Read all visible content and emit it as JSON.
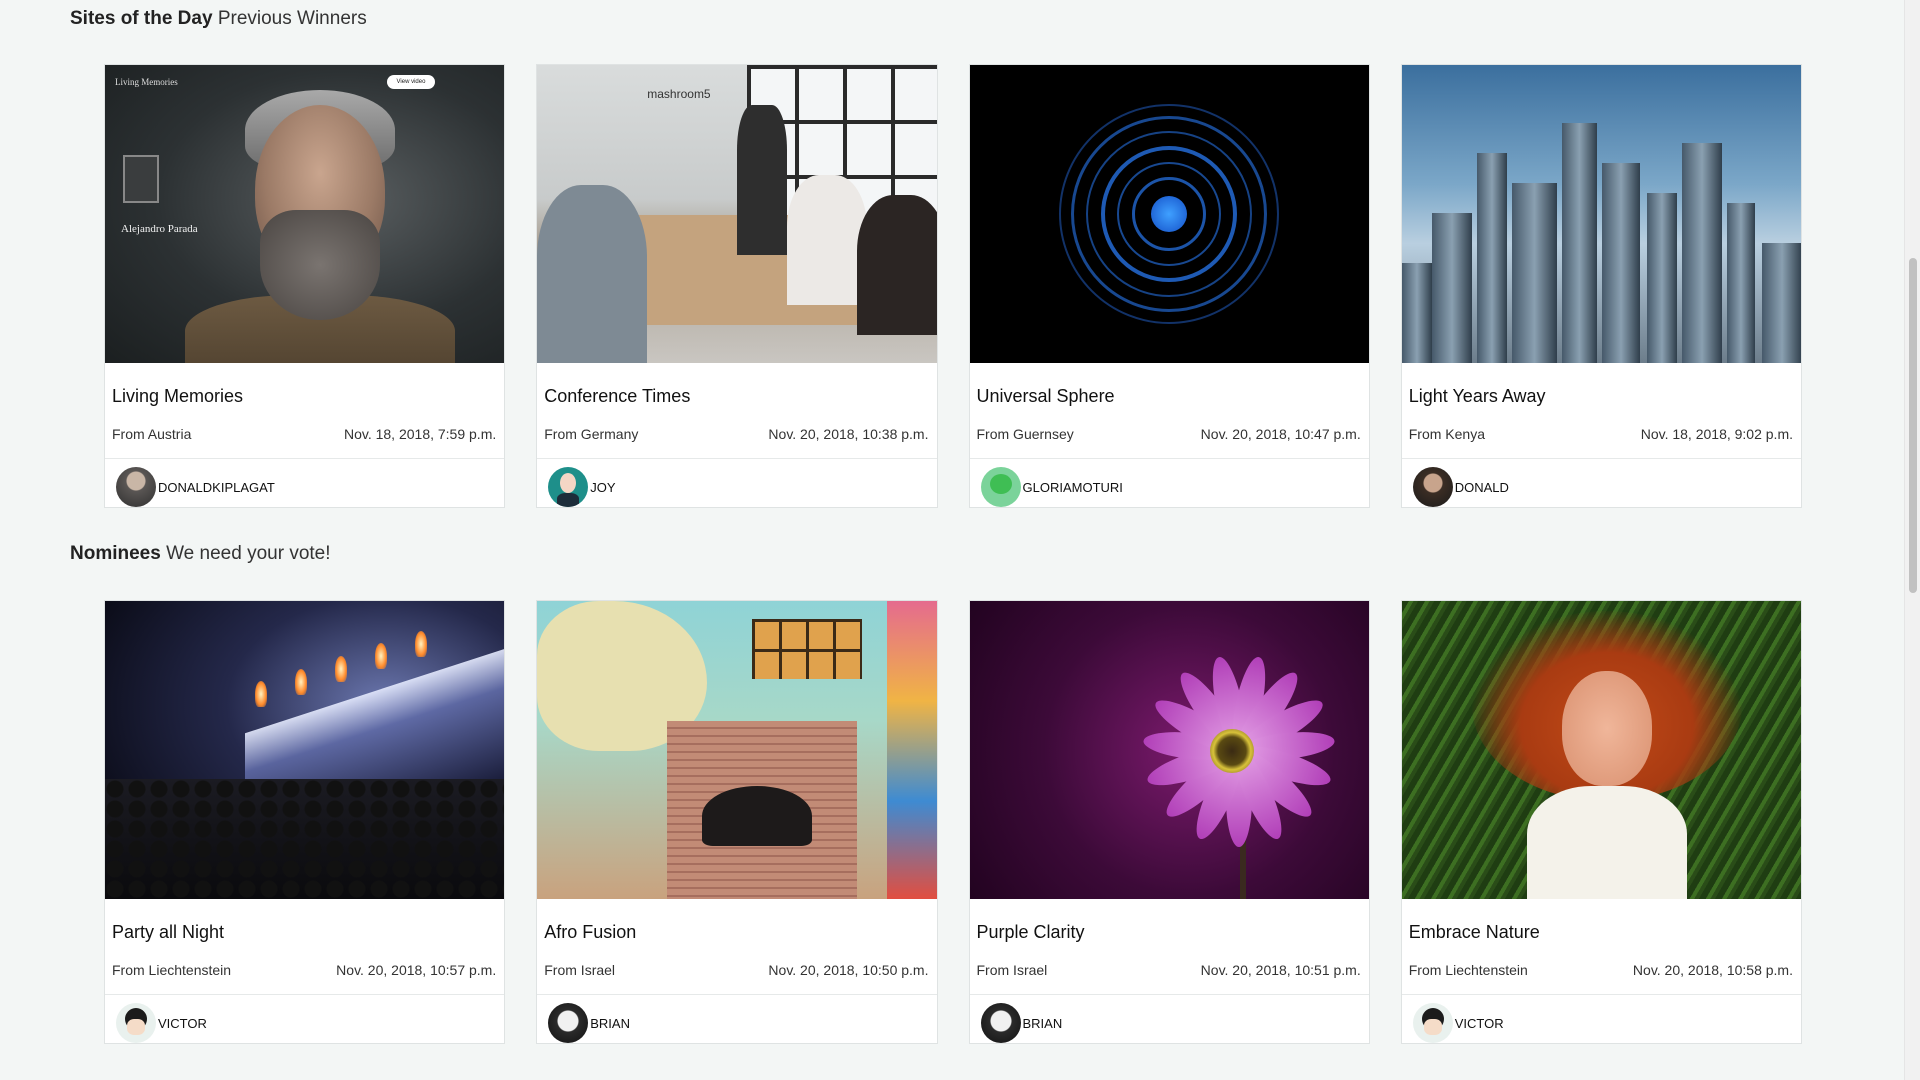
{
  "sections": {
    "winners": {
      "title": "Sites of the Day",
      "subtitle": "Previous Winners"
    },
    "nominees": {
      "title": "Nominees",
      "subtitle": "We need your vote!"
    }
  },
  "winners": [
    {
      "title": "Living Memories",
      "from": "From Austria",
      "date": "Nov. 18, 2018, 7:59 p.m.",
      "author": "DONALDKIPLAGAT",
      "thumb_text": {
        "logo": "Living Memories",
        "name": "Alejandro Parada",
        "button": "View video"
      }
    },
    {
      "title": "Conference Times",
      "from": "From Germany",
      "date": "Nov. 20, 2018, 10:38 p.m.",
      "author": "JOY",
      "thumb_text": {
        "label": "mashroom5"
      }
    },
    {
      "title": "Universal Sphere",
      "from": "From Guernsey",
      "date": "Nov. 20, 2018, 10:47 p.m.",
      "author": "GLORIAMOTURI"
    },
    {
      "title": "Light Years Away",
      "from": "From Kenya",
      "date": "Nov. 18, 2018, 9:02 p.m.",
      "author": "DONALD"
    }
  ],
  "nominees": [
    {
      "title": "Party all Night",
      "from": "From Liechtenstein",
      "date": "Nov. 20, 2018, 10:57 p.m.",
      "author": "VICTOR"
    },
    {
      "title": "Afro Fusion",
      "from": "From Israel",
      "date": "Nov. 20, 2018, 10:50 p.m.",
      "author": "BRIAN"
    },
    {
      "title": "Purple Clarity",
      "from": "From Israel",
      "date": "Nov. 20, 2018, 10:51 p.m.",
      "author": "BRIAN"
    },
    {
      "title": "Embrace Nature",
      "from": "From Liechtenstein",
      "date": "Nov. 20, 2018, 10:58 p.m.",
      "author": "VICTOR"
    }
  ],
  "colors": {
    "page_background": "#f3f6f5",
    "card_background": "#ffffff",
    "card_border": "#dfe3e3",
    "sphere_blue": "#1f6fe0"
  }
}
